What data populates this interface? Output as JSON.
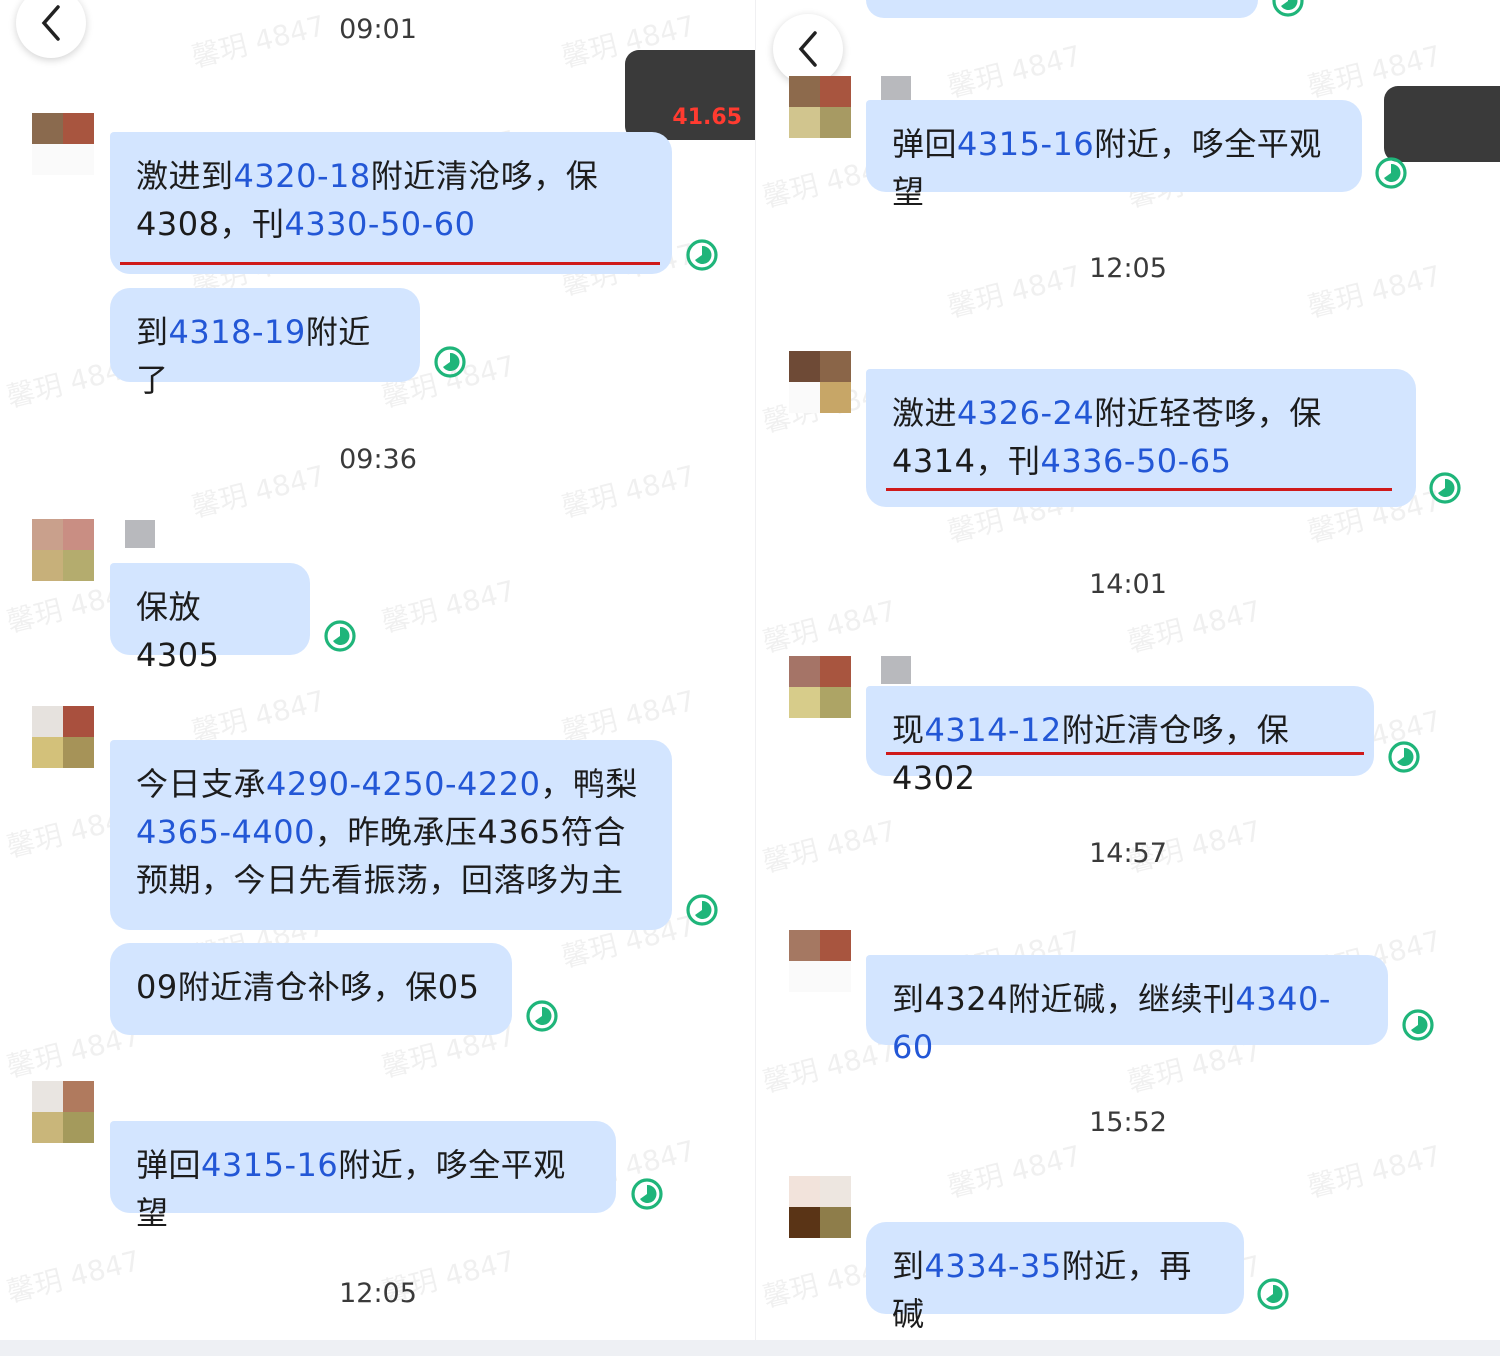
{
  "watermark": "馨玥 4847",
  "left": {
    "corner_badge": "41.65",
    "times": [
      "09:01",
      "09:36",
      "12:05"
    ],
    "messages": {
      "m1": {
        "a": "激进到",
        "n1": "4320-18",
        "b": "附近清沧哆，保",
        "c": "4308，刊",
        "n2": "4330-50-60"
      },
      "m2": {
        "a": "到",
        "n1": "4318-19",
        "b": "附近了"
      },
      "m3": {
        "a": "保放4305"
      },
      "m4": {
        "a": "今日支承",
        "n1": "4290-4250-4220",
        "b": "，鸭梨",
        "n2": "4365-4400",
        "c": "，昨晚承压4365符合",
        "d": "预期，今日先看振荡，回落哆为主"
      },
      "m5": {
        "a": "09附近清仓补哆，保05"
      },
      "m6": {
        "a": "弹回",
        "n1": "4315-16",
        "b": "附近，哆全平观望"
      }
    }
  },
  "right": {
    "times": [
      "12:05",
      "14:01",
      "14:57",
      "15:52"
    ],
    "messages": {
      "r1": {
        "a": "弹回",
        "n1": "4315-16",
        "b": "附近，哆全平观望"
      },
      "r2": {
        "a": "激进",
        "n1": "4326-24",
        "b": "附近轻苍哆，保",
        "c": "4314，刊",
        "n2": "4336-50-65"
      },
      "r3": {
        "a": "现",
        "n1": "4314-12",
        "b": "附近清仓哆，保4302"
      },
      "r4": {
        "a": "到4324附近碱，继续刊",
        "n1": "4340-60"
      },
      "r5": {
        "a": "到",
        "n1": "4334-35",
        "b": "附近，再碱"
      }
    }
  },
  "colors": {
    "bubble": "#d3e5ff",
    "number": "#2357d6",
    "underline": "#cf1a1a",
    "status": "#1fb57a"
  },
  "icons": {
    "back": "chevron-left-icon",
    "status": "sent-status-icon"
  }
}
